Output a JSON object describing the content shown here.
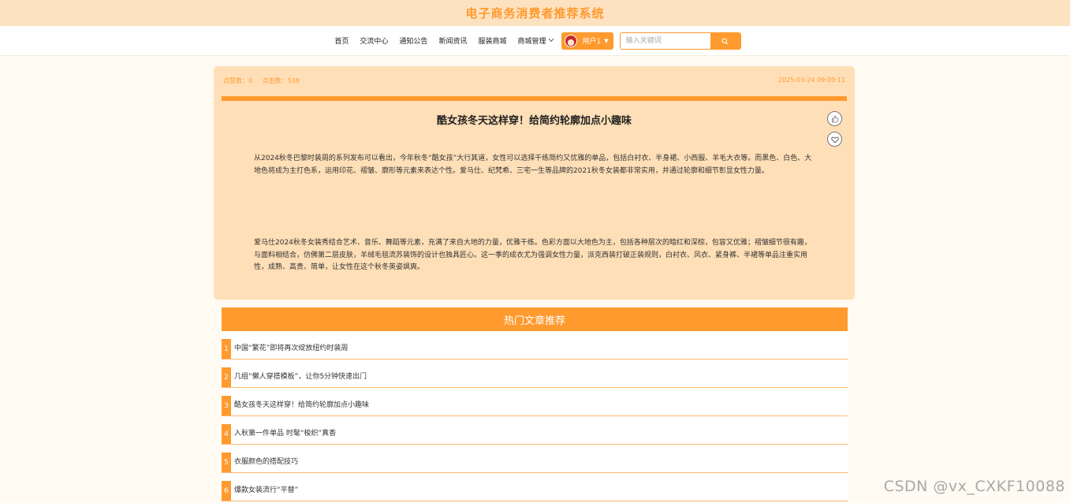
{
  "site": {
    "title": "电子商务消费者推荐系统"
  },
  "nav": {
    "items": [
      "首页",
      "交流中心",
      "通知公告",
      "新闻资讯",
      "服装商城"
    ],
    "dropdown_label": "商城管理",
    "user_label": "用户1",
    "search_placeholder": "输入关键词"
  },
  "article": {
    "likes_label": "点赞数：0",
    "clicks_label": "点击数：538",
    "datetime": "2025-03-24 09:09:11",
    "title": "酷女孩冬天这样穿！给简约轮廓加点小趣味",
    "paragraphs": [
      "从2024秋冬巴黎时装周的系列发布可以看出，今年秋冬“酷女孩”大行其道，女性可以选择干练简约又优雅的单品，包括白衬衣、半身裙、小西服、羊毛大衣等。而黑色、白色、大地色将成为主打色系，运用印花、褶皱、廓形等元素来表达个性。爱马仕、纪梵希、三宅一生等品牌的2021秋冬女装都非常实用，并通过轮廓和细节彰显女性力量。",
      "爱马仕2024秋冬女装秀结合艺术、音乐、舞蹈等元素，充满了来自大地的力量，优雅干练。色彩方面以大地色为主，包括各种层次的暗红和深棕，包容又优雅；褶皱细节很有趣，与面料相结合，仿佛第二层皮肤，羊绒毛毯流苏装饰的设计也独具匠心。这一季的成衣尤为强调女性力量，派克西装打破正装规则，白衬衣、风衣、紧身裤、半裙等单品注重实用性，成熟、高贵、简单，让女性在这个秋冬英姿飒爽。"
    ]
  },
  "hot": {
    "header": "热门文章推荐",
    "items": [
      {
        "num": "1",
        "title": "中国“繁花”即将再次绽放纽约时装周"
      },
      {
        "num": "2",
        "title": "几组“懒人穿搭模板”，让你5分钟快速出门"
      },
      {
        "num": "3",
        "title": "酷女孩冬天这样穿！给简约轮廓加点小趣味"
      },
      {
        "num": "4",
        "title": "入秋第一件单品 时髦“梭织”真香"
      },
      {
        "num": "5",
        "title": "衣服颜色的搭配技巧"
      },
      {
        "num": "6",
        "title": "爆款女装流行“平替”"
      }
    ]
  },
  "watermark": "CSDN @vx_CXKF10088",
  "colors": {
    "accent": "#ff9a2e",
    "banner": "#fde2c1",
    "card": "#ffdfb7"
  },
  "icons": [
    "search-icon",
    "thumbs-up-icon",
    "heart-icon",
    "chevron-down-icon",
    "avatar"
  ]
}
